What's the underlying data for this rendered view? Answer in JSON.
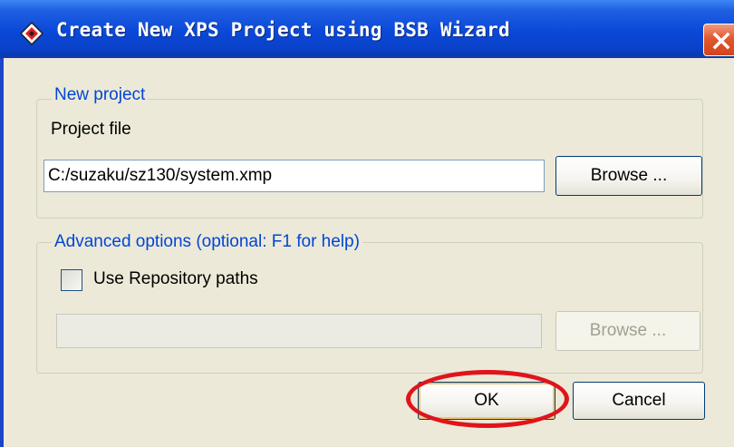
{
  "window": {
    "title": "Create New XPS Project using BSB Wizard"
  },
  "new_project": {
    "legend": "New project",
    "project_file_label": "Project file",
    "project_file_value": "C:/suzaku/sz130/system.xmp",
    "browse_label": "Browse ..."
  },
  "advanced": {
    "legend": "Advanced options (optional: F1 for help)",
    "use_repository_label": "Use Repository paths",
    "use_repository_checked": false,
    "repository_path_value": "",
    "browse_label": "Browse ..."
  },
  "buttons": {
    "ok_label": "OK",
    "cancel_label": "Cancel"
  },
  "colors": {
    "titlebar": "#0a48d8",
    "dialog_bg": "#ece9d8",
    "legend_text": "#0046d5",
    "highlight_ring": "#e0141c"
  },
  "icons": {
    "app": "xps-app-icon",
    "close": "close-icon"
  }
}
